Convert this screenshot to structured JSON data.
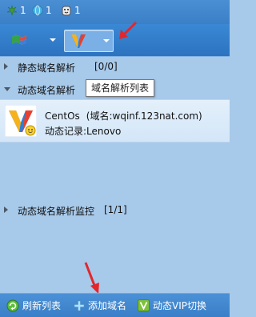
{
  "top_bar": {
    "items": [
      {
        "icon": "leaf-icon",
        "count": "1"
      },
      {
        "icon": "globe-icon",
        "count": "1"
      },
      {
        "icon": "mascot-icon",
        "count": "1"
      }
    ]
  },
  "tree": {
    "groups": [
      {
        "label": "静态域名解析",
        "count": "[0/0]",
        "expanded": false
      },
      {
        "label": "动态域名解析",
        "count": "",
        "expanded": true
      },
      {
        "label": "动态域名解析监控",
        "count": "[1/1]",
        "expanded": false
      }
    ],
    "tooltip": "域名解析列表",
    "entry": {
      "name": "CentOs",
      "domain": "(域名:wqinf.123nat.com)",
      "record": "动态记录:Lenovo"
    }
  },
  "status_bar": {
    "refresh_label": "刷新列表",
    "add_label": "添加域名",
    "vip_label": "动态VIP切换"
  },
  "colors": {
    "accent": "#3a7fc7",
    "list_bg": "#a7c9ea",
    "arrow_red": "#e3262c"
  }
}
